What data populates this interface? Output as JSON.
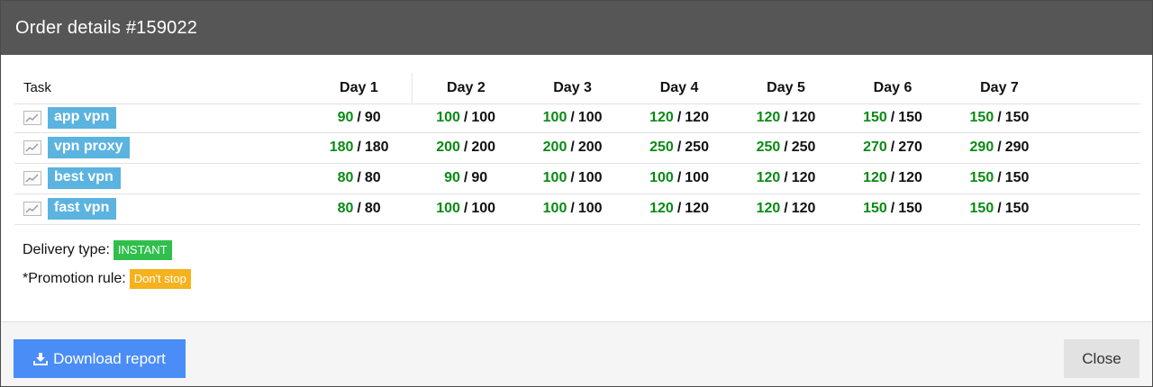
{
  "header": {
    "title": "Order details #159022"
  },
  "table": {
    "task_header": "Task",
    "days": [
      "Day 1",
      "Day 2",
      "Day 3",
      "Day 4",
      "Day 5",
      "Day 6",
      "Day 7"
    ],
    "rows": [
      {
        "label": "app vpn",
        "cells": [
          {
            "done": "90",
            "total": "90"
          },
          {
            "done": "100",
            "total": "100"
          },
          {
            "done": "100",
            "total": "100"
          },
          {
            "done": "120",
            "total": "120"
          },
          {
            "done": "120",
            "total": "120"
          },
          {
            "done": "150",
            "total": "150"
          },
          {
            "done": "150",
            "total": "150"
          }
        ]
      },
      {
        "label": "vpn proxy",
        "cells": [
          {
            "done": "180",
            "total": "180"
          },
          {
            "done": "200",
            "total": "200"
          },
          {
            "done": "200",
            "total": "200"
          },
          {
            "done": "250",
            "total": "250"
          },
          {
            "done": "250",
            "total": "250"
          },
          {
            "done": "270",
            "total": "270"
          },
          {
            "done": "290",
            "total": "290"
          }
        ]
      },
      {
        "label": "best vpn",
        "cells": [
          {
            "done": "80",
            "total": "80"
          },
          {
            "done": "90",
            "total": "90"
          },
          {
            "done": "100",
            "total": "100"
          },
          {
            "done": "100",
            "total": "100"
          },
          {
            "done": "120",
            "total": "120"
          },
          {
            "done": "120",
            "total": "120"
          },
          {
            "done": "150",
            "total": "150"
          }
        ]
      },
      {
        "label": "fast vpn",
        "cells": [
          {
            "done": "80",
            "total": "80"
          },
          {
            "done": "100",
            "total": "100"
          },
          {
            "done": "100",
            "total": "100"
          },
          {
            "done": "120",
            "total": "120"
          },
          {
            "done": "120",
            "total": "120"
          },
          {
            "done": "150",
            "total": "150"
          },
          {
            "done": "150",
            "total": "150"
          }
        ]
      }
    ]
  },
  "delivery": {
    "label": "Delivery type:",
    "value": "INSTANT"
  },
  "promotion": {
    "label": "*Promotion rule:",
    "value": "Don't stop"
  },
  "footer": {
    "download_label": "Download report",
    "close_label": "Close"
  },
  "icons": {
    "row_icon": "line-chart-icon",
    "download_icon": "download-icon"
  },
  "colors": {
    "header_bg": "#565656",
    "task_label_bg": "#5bb3e0",
    "done_value": "#0a8a15",
    "instant_badge": "#2fbf4a",
    "rule_badge": "#f5b21e",
    "download_button": "#4a8df6",
    "close_button": "#e2e2e2"
  }
}
